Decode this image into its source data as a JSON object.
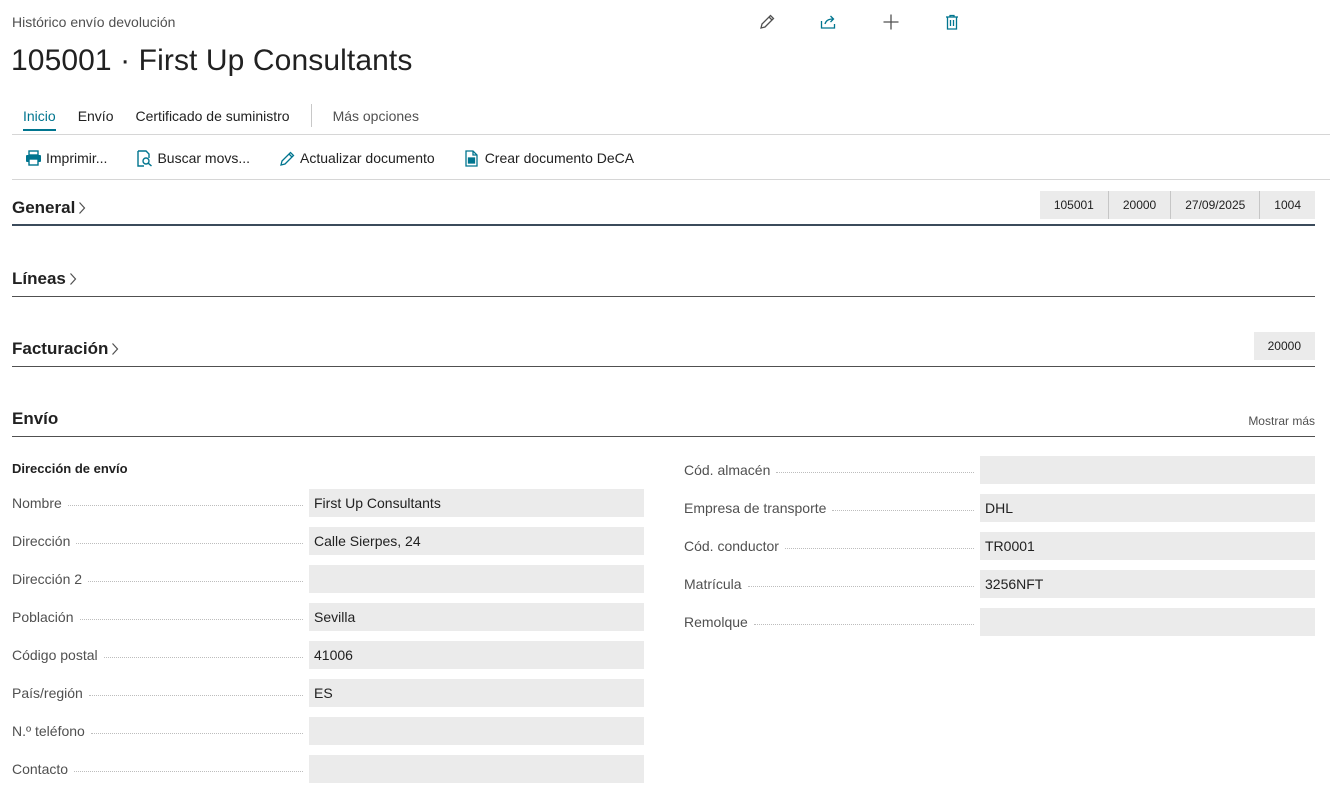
{
  "header": {
    "caption": "Histórico envío devolución",
    "title": "105001 · First Up Consultants"
  },
  "toolbar_icons": [
    "edit-icon",
    "share-icon",
    "add-icon",
    "delete-icon"
  ],
  "tabs": [
    {
      "label": "Inicio",
      "active": true
    },
    {
      "label": "Envío"
    },
    {
      "label": "Certificado de suministro"
    },
    {
      "label": "Más opciones"
    }
  ],
  "actions": [
    {
      "label": "Imprimir...",
      "icon": "printer-icon"
    },
    {
      "label": "Buscar movs...",
      "icon": "find-entries-icon"
    },
    {
      "label": "Actualizar documento",
      "icon": "pencil-icon"
    },
    {
      "label": "Crear documento DeCA",
      "icon": "document-create-icon"
    }
  ],
  "sections": {
    "general": {
      "title": "General",
      "chips": [
        "105001",
        "20000",
        "27/09/2025",
        "1004"
      ]
    },
    "lineas": {
      "title": "Líneas"
    },
    "facturacion": {
      "title": "Facturación",
      "chips": [
        "20000"
      ]
    },
    "envio": {
      "title": "Envío",
      "show_more": "Mostrar más"
    }
  },
  "envio": {
    "subheading": "Dirección de envío",
    "left_fields": [
      {
        "label": "Nombre",
        "value": "First Up Consultants"
      },
      {
        "label": "Dirección",
        "value": "Calle Sierpes, 24"
      },
      {
        "label": "Dirección 2",
        "value": ""
      },
      {
        "label": "Población",
        "value": "Sevilla"
      },
      {
        "label": "Código postal",
        "value": "41006"
      },
      {
        "label": "País/región",
        "value": "ES"
      },
      {
        "label": "N.º teléfono",
        "value": ""
      },
      {
        "label": "Contacto",
        "value": ""
      }
    ],
    "right_fields": [
      {
        "label": "Cód. almacén",
        "value": ""
      },
      {
        "label": "Empresa de transporte",
        "value": "DHL"
      },
      {
        "label": "Cód. conductor",
        "value": "TR0001"
      },
      {
        "label": "Matrícula",
        "value": "3256NFT"
      },
      {
        "label": "Remolque",
        "value": ""
      }
    ]
  },
  "colors": {
    "accent": "#00758f",
    "field_bg": "#ebebeb"
  }
}
